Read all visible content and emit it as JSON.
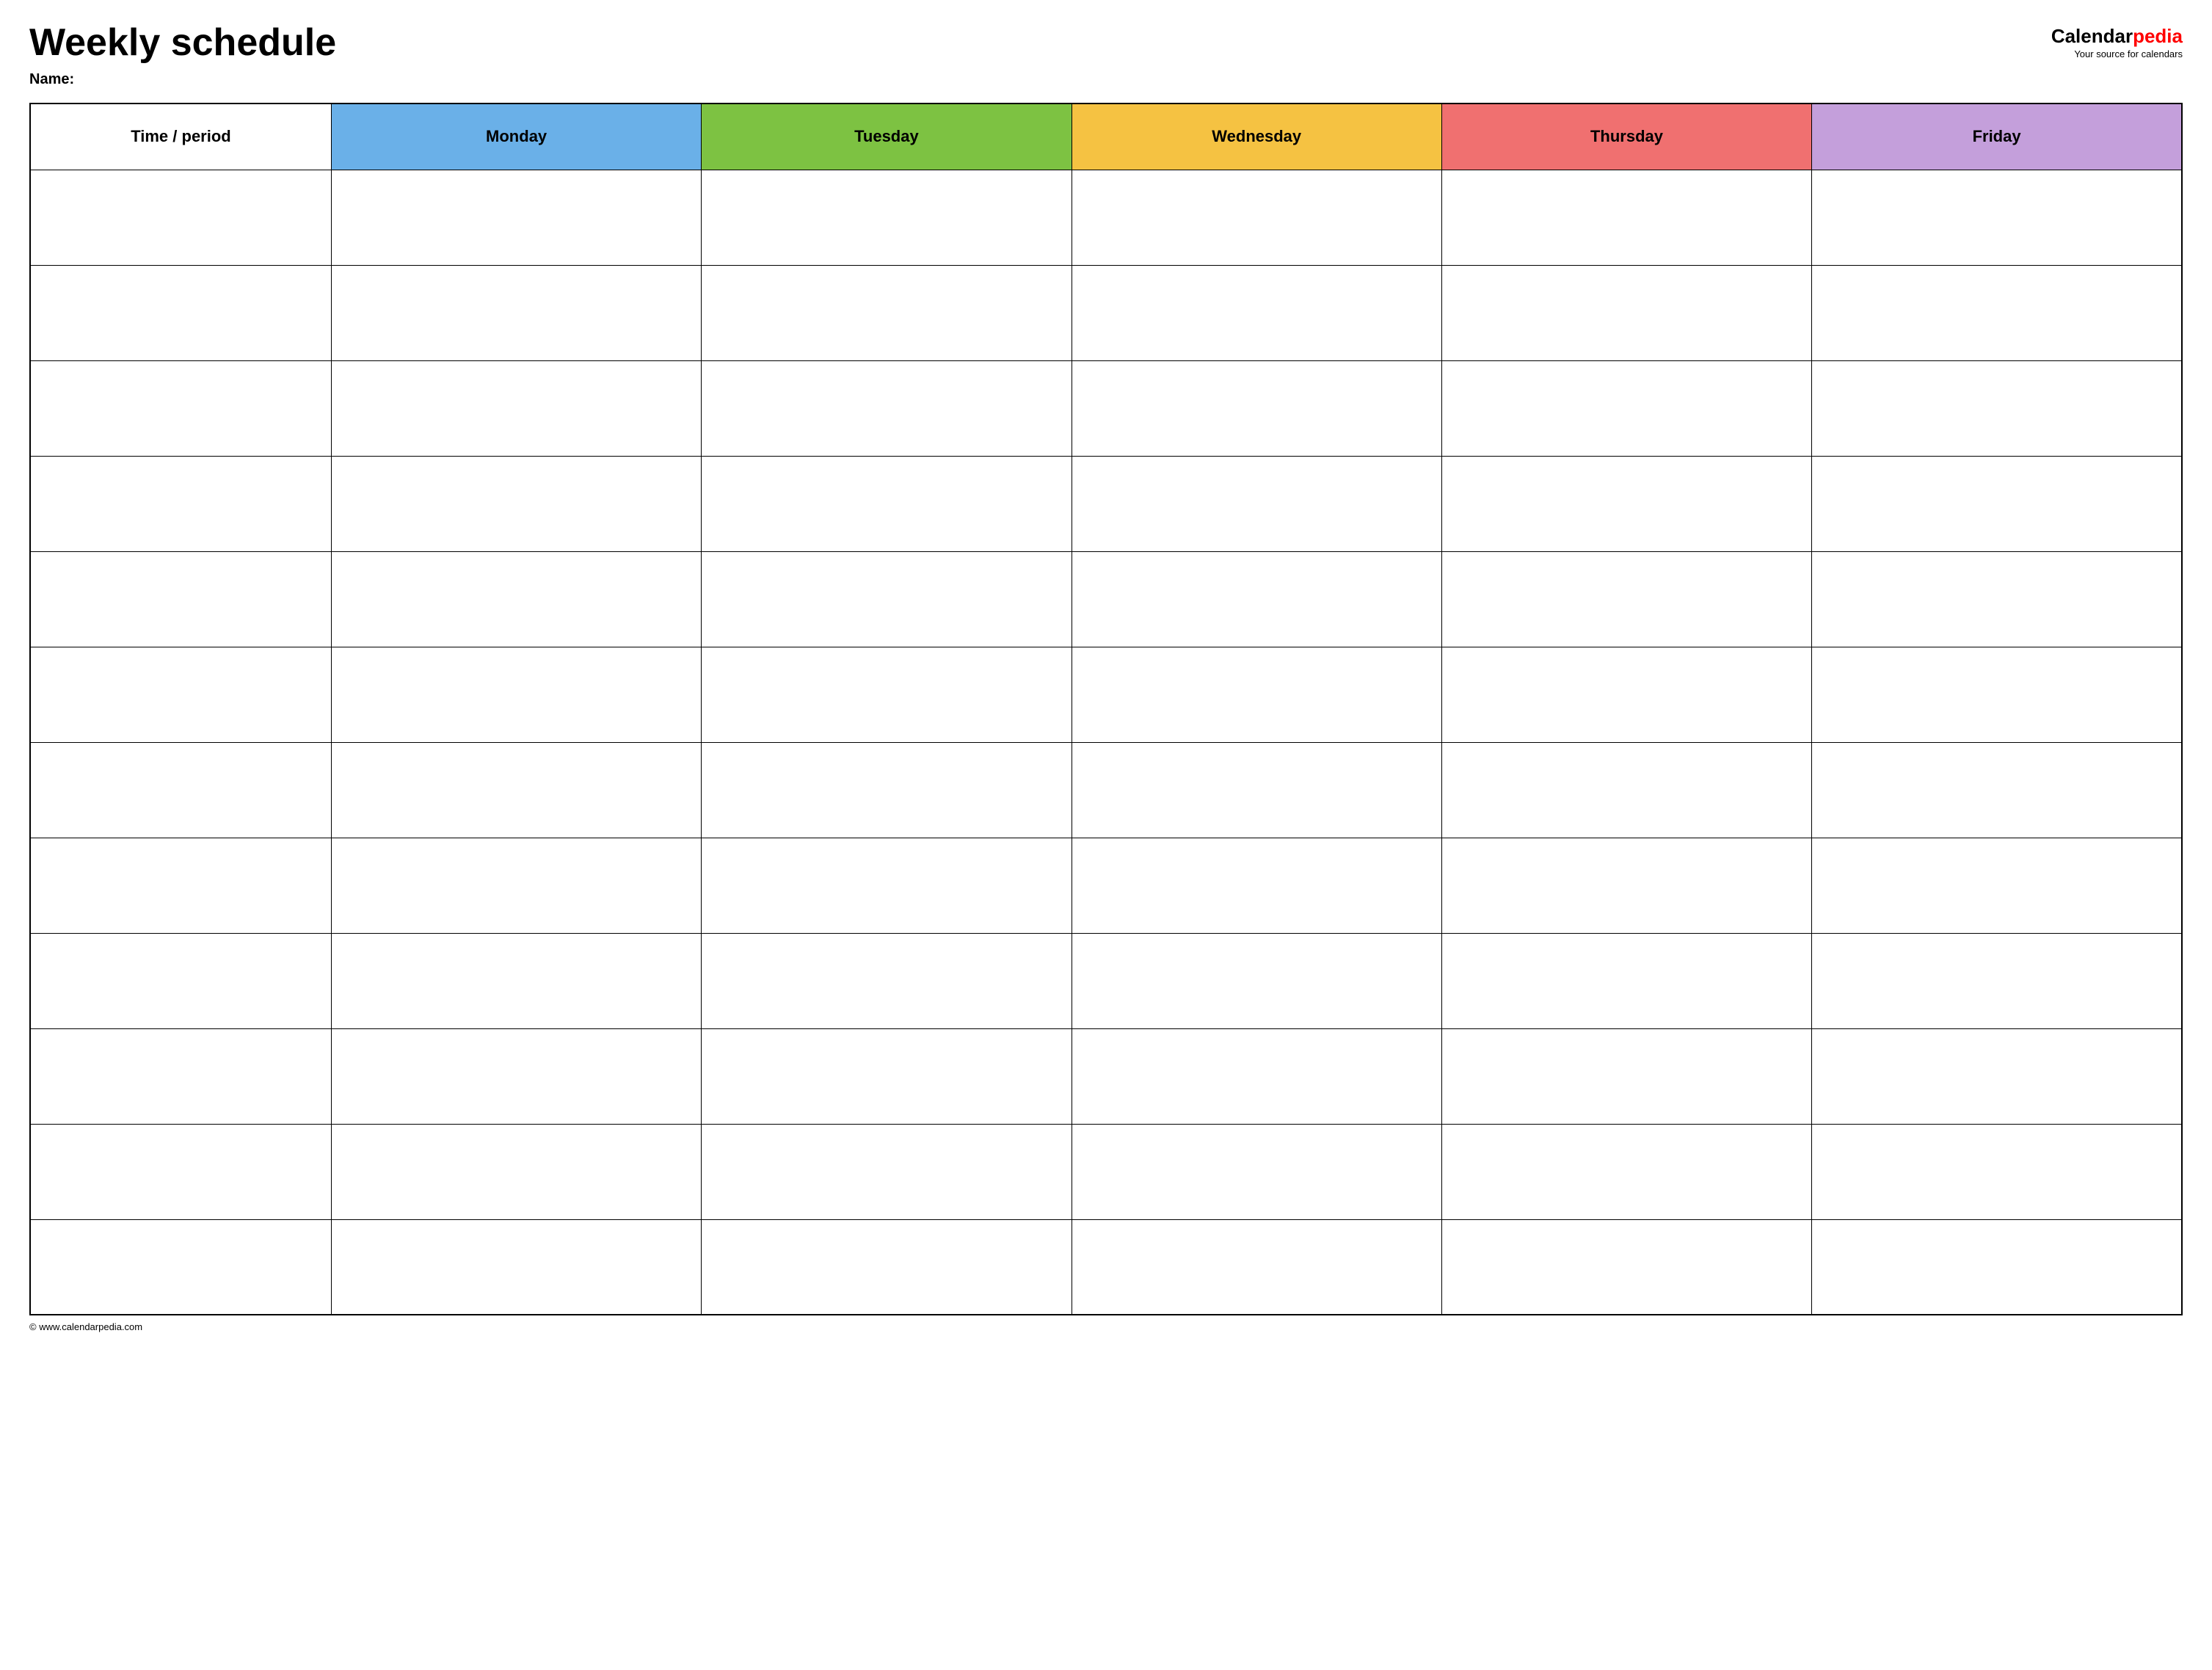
{
  "header": {
    "title": "Weekly schedule",
    "name_label": "Name:",
    "logo": {
      "calendar": "Calendar",
      "pedia": "pedia",
      "tagline": "Your source for calendars"
    }
  },
  "table": {
    "columns": [
      {
        "id": "time",
        "label": "Time / period",
        "color": "#ffffff"
      },
      {
        "id": "monday",
        "label": "Monday",
        "color": "#6ab0e8"
      },
      {
        "id": "tuesday",
        "label": "Tuesday",
        "color": "#7dc242"
      },
      {
        "id": "wednesday",
        "label": "Wednesday",
        "color": "#f5c242"
      },
      {
        "id": "thursday",
        "label": "Thursday",
        "color": "#f07070"
      },
      {
        "id": "friday",
        "label": "Friday",
        "color": "#c49fdb"
      }
    ],
    "row_count": 12
  },
  "footer": {
    "text": "© www.calendarpedia.com"
  }
}
